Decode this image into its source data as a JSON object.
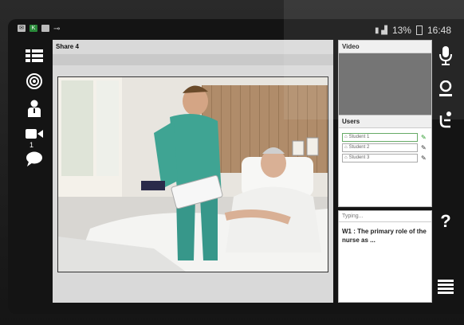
{
  "status_bar": {
    "battery": "13%",
    "time": "16:48",
    "left_icons": [
      "mail-icon",
      "k-icon",
      "image-icon",
      "key-icon"
    ]
  },
  "main": {
    "title": "Share 4"
  },
  "left_rail": {
    "participant_count": "1",
    "icons": [
      "slides-icon",
      "target-icon",
      "person-icon",
      "camera-icon",
      "chat-icon"
    ]
  },
  "video_panel": {
    "title": "Video"
  },
  "users_panel": {
    "title": "Users",
    "users": [
      {
        "name": "Student 1",
        "active": true
      },
      {
        "name": "Student 2",
        "active": false
      },
      {
        "name": "Student 3",
        "active": false
      }
    ]
  },
  "typing_panel": {
    "label": "Typing...",
    "text": "W1 : The primary role of the nurse as ..."
  },
  "right_rail": {
    "help": "?",
    "icons": [
      "mic-icon",
      "user-icon",
      "raise-hand-icon",
      "help-icon",
      "menu-icon"
    ]
  },
  "colors": {
    "dark_background": "#141414",
    "panel_white": "#ffffff",
    "accent_green": "#2a9a2a"
  }
}
